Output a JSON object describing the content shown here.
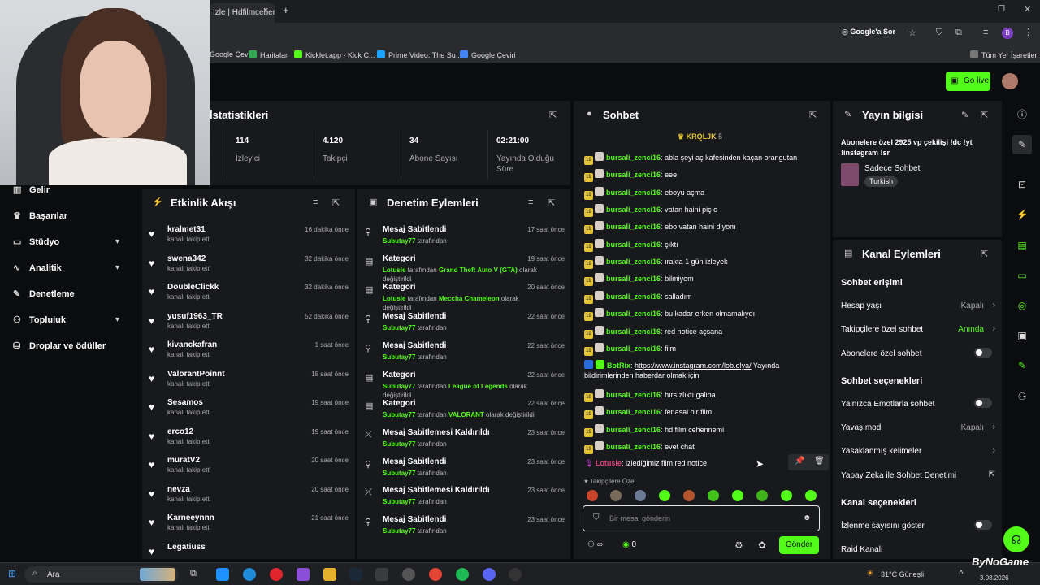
{
  "browser": {
    "tab_title": "İzle | Hdfilmcehenn",
    "tab_close": "×",
    "tab_new": "+",
    "google_search": "Google'a Sor",
    "all_bookmarks": "Tüm Yer İşaretleri",
    "bookmarks": [
      {
        "label": "Google Çeviri",
        "color": "#4285f4"
      },
      {
        "label": "Haritalar",
        "color": "#34a853"
      },
      {
        "label": "Kicklet.app - Kick C...",
        "color": "#53fc18"
      },
      {
        "label": "Prime Video: The Su...",
        "color": "#1aa3ff"
      },
      {
        "label": "Google Çeviri",
        "color": "#4285f4"
      }
    ],
    "profile_initial": "B"
  },
  "header": {
    "go_live": "Go live"
  },
  "sidebar": {
    "items": [
      {
        "label": "Gelir",
        "icon": "chart-icon"
      },
      {
        "label": "Başarılar",
        "icon": "trophy-icon"
      },
      {
        "label": "Stüdyo",
        "icon": "studio-icon"
      },
      {
        "label": "Analitik",
        "icon": "analytics-icon"
      },
      {
        "label": "Denetleme",
        "icon": "wrench-icon"
      },
      {
        "label": "Topluluk",
        "icon": "people-icon"
      },
      {
        "label": "Droplar ve ödüller",
        "icon": "drops-icon"
      }
    ]
  },
  "stats": {
    "title": "İstatistikleri",
    "items": [
      {
        "value": "114",
        "label": "İzleyici"
      },
      {
        "value": "4.120",
        "label": "Takipçi"
      },
      {
        "value": "34",
        "label": "Abone Sayısı"
      },
      {
        "value": "02:21:00",
        "label": "Yayında Olduğu Süre"
      }
    ]
  },
  "activity": {
    "title": "Etkinlik Akışı",
    "items": [
      {
        "name": "kralmet31",
        "sub": "kanalı takip etti",
        "time": "16 dakika önce"
      },
      {
        "name": "swena342",
        "sub": "kanalı takip etti",
        "time": "32 dakika önce"
      },
      {
        "name": "DoubleClickk",
        "sub": "kanalı takip etti",
        "time": "32 dakika önce"
      },
      {
        "name": "yusuf1963_TR",
        "sub": "kanalı takip etti",
        "time": "52 dakika önce"
      },
      {
        "name": "kivanckafran",
        "sub": "kanalı takip etti",
        "time": "1 saat önce"
      },
      {
        "name": "ValorantPoinnt",
        "sub": "kanalı takip etti",
        "time": "18 saat önce"
      },
      {
        "name": "Sesamos",
        "sub": "kanalı takip etti",
        "time": "19 saat önce"
      },
      {
        "name": "erco12",
        "sub": "kanalı takip etti",
        "time": "19 saat önce"
      },
      {
        "name": "muratV2",
        "sub": "kanalı takip etti",
        "time": "20 saat önce"
      },
      {
        "name": "nevza",
        "sub": "kanalı takip etti",
        "time": "20 saat önce"
      },
      {
        "name": "Karneeynnn",
        "sub": "kanalı takip etti",
        "time": "21 saat önce"
      },
      {
        "name": "Legatiuss",
        "sub": "",
        "time": ""
      }
    ]
  },
  "moderation": {
    "title": "Denetim Eylemleri",
    "items": [
      {
        "icon": "pin-icon",
        "title": "Mesaj Sabitlendi",
        "time": "17 saat önce",
        "user": "Subutay77",
        "pre": "",
        "mid": " tarafından",
        "hl": "",
        "post": ""
      },
      {
        "icon": "category-icon",
        "title": "Kategori",
        "time": "19 saat önce",
        "user": "Lotusle",
        "pre": "",
        "mid": " tarafından ",
        "hl": "Grand Theft Auto V (GTA)",
        "post": " olarak değiştirildi"
      },
      {
        "icon": "category-icon",
        "title": "Kategori",
        "time": "20 saat önce",
        "user": "Lotusle",
        "pre": "",
        "mid": " tarafından ",
        "hl": "Meccha Chameleon",
        "post": " olarak değiştirildi"
      },
      {
        "icon": "pin-icon",
        "title": "Mesaj Sabitlendi",
        "time": "22 saat önce",
        "user": "Subutay77",
        "pre": "",
        "mid": " tarafından",
        "hl": "",
        "post": ""
      },
      {
        "icon": "pin-icon",
        "title": "Mesaj Sabitlendi",
        "time": "22 saat önce",
        "user": "Subutay77",
        "pre": "",
        "mid": " tarafından",
        "hl": "",
        "post": ""
      },
      {
        "icon": "category-icon",
        "title": "Kategori",
        "time": "22 saat önce",
        "user": "Subutay77",
        "pre": "",
        "mid": " tarafından ",
        "hl": "League of Legends",
        "post": " olarak değiştirildi"
      },
      {
        "icon": "category-icon",
        "title": "Kategori",
        "time": "22 saat önce",
        "user": "Subutay77",
        "pre": "",
        "mid": " tarafından ",
        "hl": "VALORANT",
        "post": " olarak değiştirildi"
      },
      {
        "icon": "unpin-icon",
        "title": "Mesaj Sabitlemesi Kaldırıldı",
        "time": "23 saat önce",
        "user": "Subutay77",
        "pre": "",
        "mid": " tarafından",
        "hl": "",
        "post": ""
      },
      {
        "icon": "pin-icon",
        "title": "Mesaj Sabitlendi",
        "time": "23 saat önce",
        "user": "Subutay77",
        "pre": "",
        "mid": " tarafından",
        "hl": "",
        "post": ""
      },
      {
        "icon": "unpin-icon",
        "title": "Mesaj Sabitlemesi Kaldırıldı",
        "time": "23 saat önce",
        "user": "Subutay77",
        "pre": "",
        "mid": " tarafından",
        "hl": "",
        "post": ""
      },
      {
        "icon": "pin-icon",
        "title": "Mesaj Sabitlendi",
        "time": "23 saat önce",
        "user": "Subutay77",
        "pre": "",
        "mid": " tarafından",
        "hl": "",
        "post": ""
      }
    ]
  },
  "chat": {
    "title": "Sohbet",
    "top_user": "KRQLJK",
    "top_count": "5",
    "messages": [
      {
        "user": "bursali_zenci16",
        "text": "abla şeyi aç kafesinden kaçan orangutan"
      },
      {
        "user": "bursali_zenci16",
        "text": "eee"
      },
      {
        "user": "bursali_zenci16",
        "text": "eboyu açma"
      },
      {
        "user": "bursali_zenci16",
        "text": "vatan haini piç o"
      },
      {
        "user": "bursali_zenci16",
        "text": "ebo vatan haini diyom"
      },
      {
        "user": "bursali_zenci16",
        "text": "çıktı"
      },
      {
        "user": "bursali_zenci16",
        "text": "ırakta 1 gün izleyek"
      },
      {
        "user": "bursali_zenci16",
        "text": "bilmiyom"
      },
      {
        "user": "bursali_zenci16",
        "text": "salladım"
      },
      {
        "user": "bursali_zenci16",
        "text": "bu kadar erken olmamalıydı"
      },
      {
        "user": "bursali_zenci16",
        "text": "red notice açsana"
      },
      {
        "user": "bursali_zenci16",
        "text": "film"
      }
    ],
    "bot": {
      "user": "BotRix",
      "link": "https://www.instagram.com/lob.elya/",
      "text": " Yayında bildirimlerinden haberdar olmak için"
    },
    "messages2": [
      {
        "user": "bursali_zenci16",
        "text": "hırsızlıktı galiba"
      },
      {
        "user": "bursali_zenci16",
        "text": "fenasal bir film"
      },
      {
        "user": "bursali_zenci16",
        "text": "hd film cehennemi"
      },
      {
        "user": "bursali_zenci16",
        "text": "evet chat"
      }
    ],
    "lotus": {
      "user": "Lotusle",
      "text": "izlediğimiz film red notice"
    },
    "followers_only": "Takipçilere Özel",
    "badge_num": "19",
    "input_placeholder": "Bir mesaj gönderin",
    "count": "0",
    "send": "Gönder"
  },
  "stream_info": {
    "title": "Yayın bilgisi",
    "stream_title": "Abonelere özel 2925 vp çekilişi !dc !yt !instagram !sr",
    "category": "Sadece Sohbet",
    "tag": "Turkish"
  },
  "channel_actions": {
    "title": "Kanal Eylemleri",
    "chat_access": "Sohbet erişimi",
    "account_age": "Hesap yaşı",
    "account_age_val": "Kapalı",
    "followers_chat": "Takipçilere özel sohbet",
    "followers_chat_val": "Anında",
    "subs_chat": "Abonelere özel sohbet",
    "chat_options": "Sohbet seçenekleri",
    "emote_only": "Yalnızca Emotlarla sohbet",
    "slow_mode": "Yavaş mod",
    "slow_mode_val": "Kapalı",
    "banned_words": "Yasaklanmış kelimeler",
    "ai_mod": "Yapay Zeka ile Sohbet Denetimi",
    "channel_options": "Kanal seçenekleri",
    "show_views": "İzlenme sayısını göster",
    "raid": "Raid Kanalı"
  },
  "taskbar": {
    "search": "Ara",
    "weather": "31°C  Güneşli",
    "date": "3.08.2026",
    "watermark": "ByNoGame"
  },
  "colors": {
    "accent": "#53fc18",
    "panel": "#18191c",
    "bg": "#0b0c0e"
  }
}
